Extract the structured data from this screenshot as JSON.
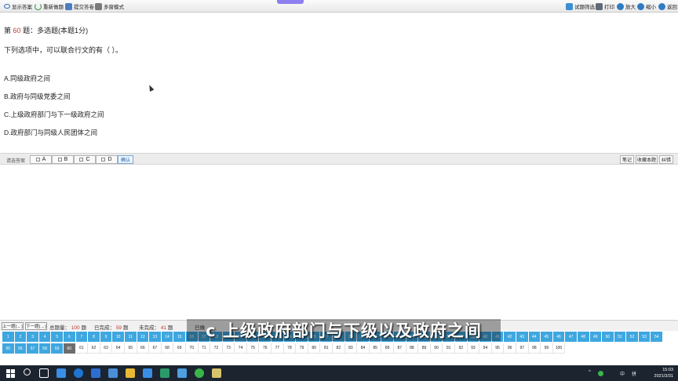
{
  "toolbar": {
    "left": [
      {
        "label": "显示答案",
        "icon": "eye-icon"
      },
      {
        "label": "重新做题",
        "icon": "refresh-icon"
      },
      {
        "label": "提交答卷",
        "icon": "document-icon"
      },
      {
        "label": "多窗模式",
        "icon": "windows-icon"
      }
    ],
    "right": [
      {
        "label": "试题筛选",
        "icon": "filter-icon"
      },
      {
        "label": "打印",
        "icon": "printer-icon"
      },
      {
        "label": "放大",
        "icon": "zoom-in-icon"
      },
      {
        "label": "缩小",
        "icon": "zoom-out-icon"
      },
      {
        "label": "返回",
        "icon": "back-icon"
      }
    ]
  },
  "question": {
    "prefix": "第",
    "number": "60",
    "suffix": "题：多选题(本题1分)",
    "text": "下列选项中，可以联合行文的有（ ）。",
    "options": [
      "A.同级政府之间",
      "B.政府与同级党委之间",
      "C.上级政府部门与下一级政府之间",
      "D.政府部门与同级人民团体之间"
    ]
  },
  "answer_bar": {
    "label": "请选答案",
    "choices": [
      "A",
      "B",
      "C",
      "D"
    ],
    "confirm": "确认",
    "right_buttons": [
      "笔记",
      "收藏本题",
      "纠错"
    ]
  },
  "status": {
    "prev": "上一题(←)",
    "next": "下一题(→)",
    "total_label": "总题量：",
    "total": "100",
    "total_unit": "题",
    "done_label": "已完成：",
    "done": "59",
    "done_unit": "题",
    "todo_label": "未完成：",
    "todo": "41",
    "todo_unit": "题",
    "hint": "已做"
  },
  "grid": {
    "row1": [
      "1",
      "2",
      "3",
      "4",
      "5",
      "6",
      "7",
      "8",
      "9",
      "10",
      "11",
      "12",
      "13",
      "14",
      "15",
      "16",
      "17",
      "18",
      "19",
      "20",
      "21",
      "22",
      "23",
      "24",
      "25",
      "26",
      "27",
      "28",
      "29",
      "30",
      "31",
      "32",
      "33",
      "34",
      "35",
      "36",
      "37",
      "38",
      "39",
      "40",
      "41",
      "42",
      "43",
      "44",
      "45",
      "46",
      "47",
      "48",
      "49",
      "50",
      "51",
      "52",
      "53",
      "54"
    ],
    "row2": [
      "55",
      "56",
      "57",
      "58",
      "59",
      "60",
      "61",
      "62",
      "63",
      "64",
      "65",
      "66",
      "67",
      "68",
      "69",
      "70",
      "71",
      "72",
      "73",
      "74",
      "75",
      "76",
      "77",
      "78",
      "79",
      "80",
      "81",
      "82",
      "83",
      "84",
      "85",
      "86",
      "87",
      "88",
      "89",
      "90",
      "91",
      "92",
      "93",
      "94",
      "95",
      "96",
      "97",
      "98",
      "99",
      "100"
    ],
    "completed_through": 59,
    "current": 60
  },
  "subtitle": "c 上级政府部门与下级以及政府之间",
  "taskbar": {
    "apps": [
      "windows-start-icon",
      "search-icon",
      "task-view-icon",
      "mail-icon",
      "edge-icon",
      "store-icon",
      "app-icon",
      "file-explorer-icon",
      "sixty-icon",
      "exam-app-icon",
      "photos-icon",
      "wechat-icon",
      "tshirt-icon"
    ],
    "tray": [
      "^",
      "中",
      "拼"
    ],
    "time": "15:03",
    "date": "2021/3/31"
  }
}
